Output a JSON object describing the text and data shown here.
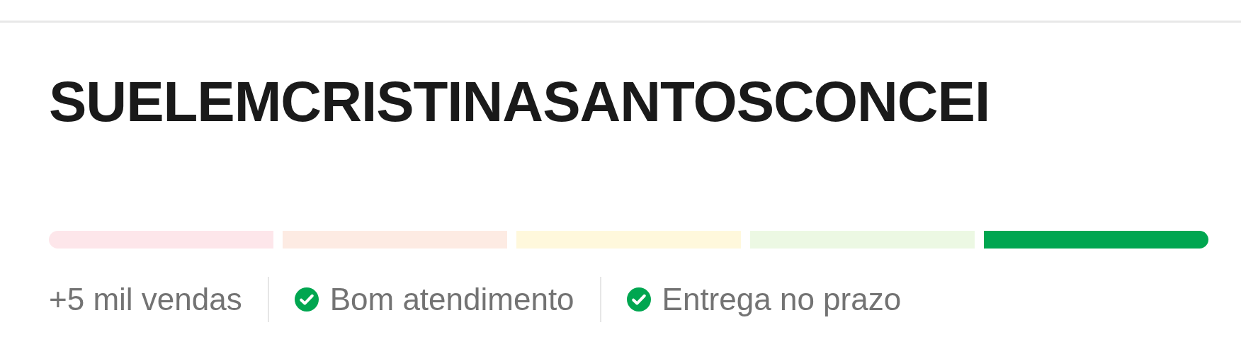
{
  "seller": {
    "name": "SUELEMCRISTINASANTOSCONCEI"
  },
  "thermometer": [
    {
      "color": "#fde6ea"
    },
    {
      "color": "#fdebe3"
    },
    {
      "color": "#fff8dc"
    },
    {
      "color": "#ecf8e3"
    },
    {
      "color": "#00a650"
    }
  ],
  "stats": [
    {
      "kind": "text",
      "label": "+5 mil vendas"
    },
    {
      "kind": "check",
      "label": "Bom atendimento"
    },
    {
      "kind": "check",
      "label": "Entrega no prazo"
    }
  ]
}
